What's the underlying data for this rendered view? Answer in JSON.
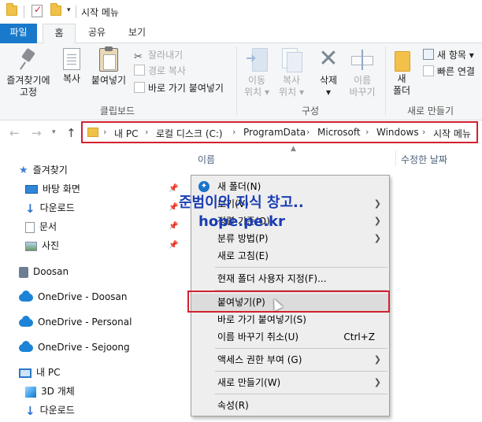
{
  "window": {
    "title": "시작 메뉴"
  },
  "ribbon_tabs": [
    {
      "label": "파일"
    },
    {
      "label": "홈"
    },
    {
      "label": "공유"
    },
    {
      "label": "보기"
    }
  ],
  "ribbon": {
    "clipboard": {
      "pin_label_1": "즐겨찾기에",
      "pin_label_2": "고정",
      "copy": "복사",
      "paste": "붙여넣기",
      "cut": "잘라내기",
      "copy_path": "경로 복사",
      "paste_shortcut": "바로 가기 붙여넣기",
      "group": "클립보드"
    },
    "organize": {
      "move_1": "이동",
      "move_2": "위치",
      "copy_1": "복사",
      "copy_2": "위치",
      "delete": "삭제",
      "rename_1": "이름",
      "rename_2": "바꾸기",
      "group": "구성"
    },
    "new": {
      "new_folder_1": "새",
      "new_folder_2": "폴더",
      "new_item": "새 항목",
      "easy_access": "빠른 연결",
      "group": "새로 만들기"
    }
  },
  "address": {
    "crumbs": [
      "내 PC",
      "로컬 디스크 (C:)",
      "ProgramData",
      "Microsoft",
      "Windows",
      "시작 메뉴"
    ]
  },
  "columns": {
    "name": "이름",
    "date": "수정한 날짜"
  },
  "nav": {
    "quick_access": "즐겨찾기",
    "items": [
      {
        "label": "바탕 화면"
      },
      {
        "label": "다운로드"
      },
      {
        "label": "문서"
      },
      {
        "label": "사진"
      }
    ],
    "doosan": "Doosan",
    "onedrive_doosan": "OneDrive - Doosan",
    "onedrive_personal": "OneDrive - Personal",
    "onedrive_sejoong": "OneDrive - Sejoong",
    "this_pc": "내 PC",
    "objects_3d": "3D 개체",
    "downloads_pc": "다운로드"
  },
  "context_menu": {
    "new_folder": "새 폴더(N)",
    "view": "보기(V)",
    "sort": "정렬 기준(O)",
    "group": "분류 방법(P)",
    "refresh": "새로 고침(E)",
    "customize": "현재 폴더 사용자 지정(F)...",
    "paste": "붙여넣기(P)",
    "paste_shortcut": "바로 가기 붙여넣기(S)",
    "undo_rename": "이름 바꾸기 취소(U)",
    "undo_shortcut": "Ctrl+Z",
    "access": "액세스 권한 부여 (G)",
    "new": "새로 만들기(W)",
    "properties": "속성(R)"
  },
  "watermark": {
    "line1": "준범이의 지식 창고..",
    "line2": "hope.pe.kr"
  },
  "colors": {
    "file_tab": "#1979ca",
    "highlight_red": "#d32030"
  }
}
